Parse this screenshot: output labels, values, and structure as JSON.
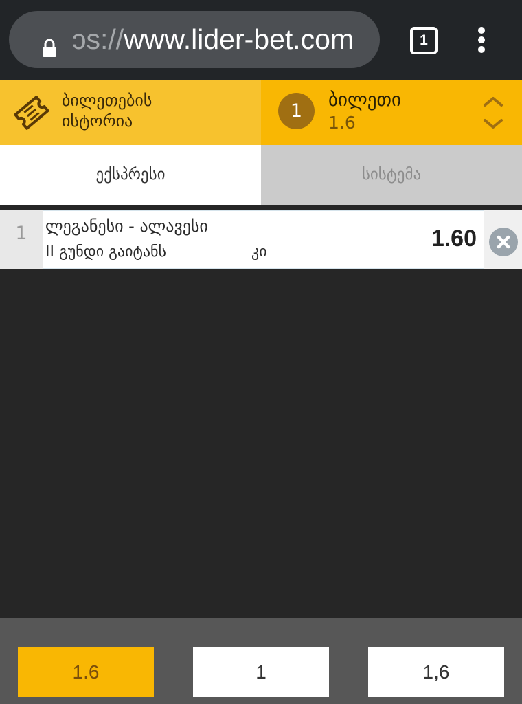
{
  "browser": {
    "url_scheme": "ɔs://",
    "url_host": "www.lider-bet.com",
    "tab_count": "1",
    "icons": {
      "lock": "lock-icon",
      "menu": "more-vertical-icon"
    }
  },
  "ticket_header": {
    "history_label_line1": "ბილეთების",
    "history_label_line2": "ისტორია",
    "ticket_count": "1",
    "ticket_title": "ბილეთი",
    "ticket_odds": "1.6"
  },
  "tabs": [
    {
      "label": "ექსპრესი",
      "active": true
    },
    {
      "label": "სისტემა",
      "active": false
    }
  ],
  "bets": [
    {
      "number": "1",
      "match": "ლეგანესი - ალავესი",
      "market": "II გუნდი გაიტანს",
      "selection": "კი",
      "odds": "1.60"
    }
  ],
  "footer": {
    "total_odds": "1.6",
    "stake": "1",
    "possible_win": "1,6"
  },
  "colors": {
    "accent": "#f9b703",
    "accent_light": "#f7c22e",
    "badge": "#a06f12",
    "content_bg": "#262626",
    "footer_bg": "#575757"
  }
}
